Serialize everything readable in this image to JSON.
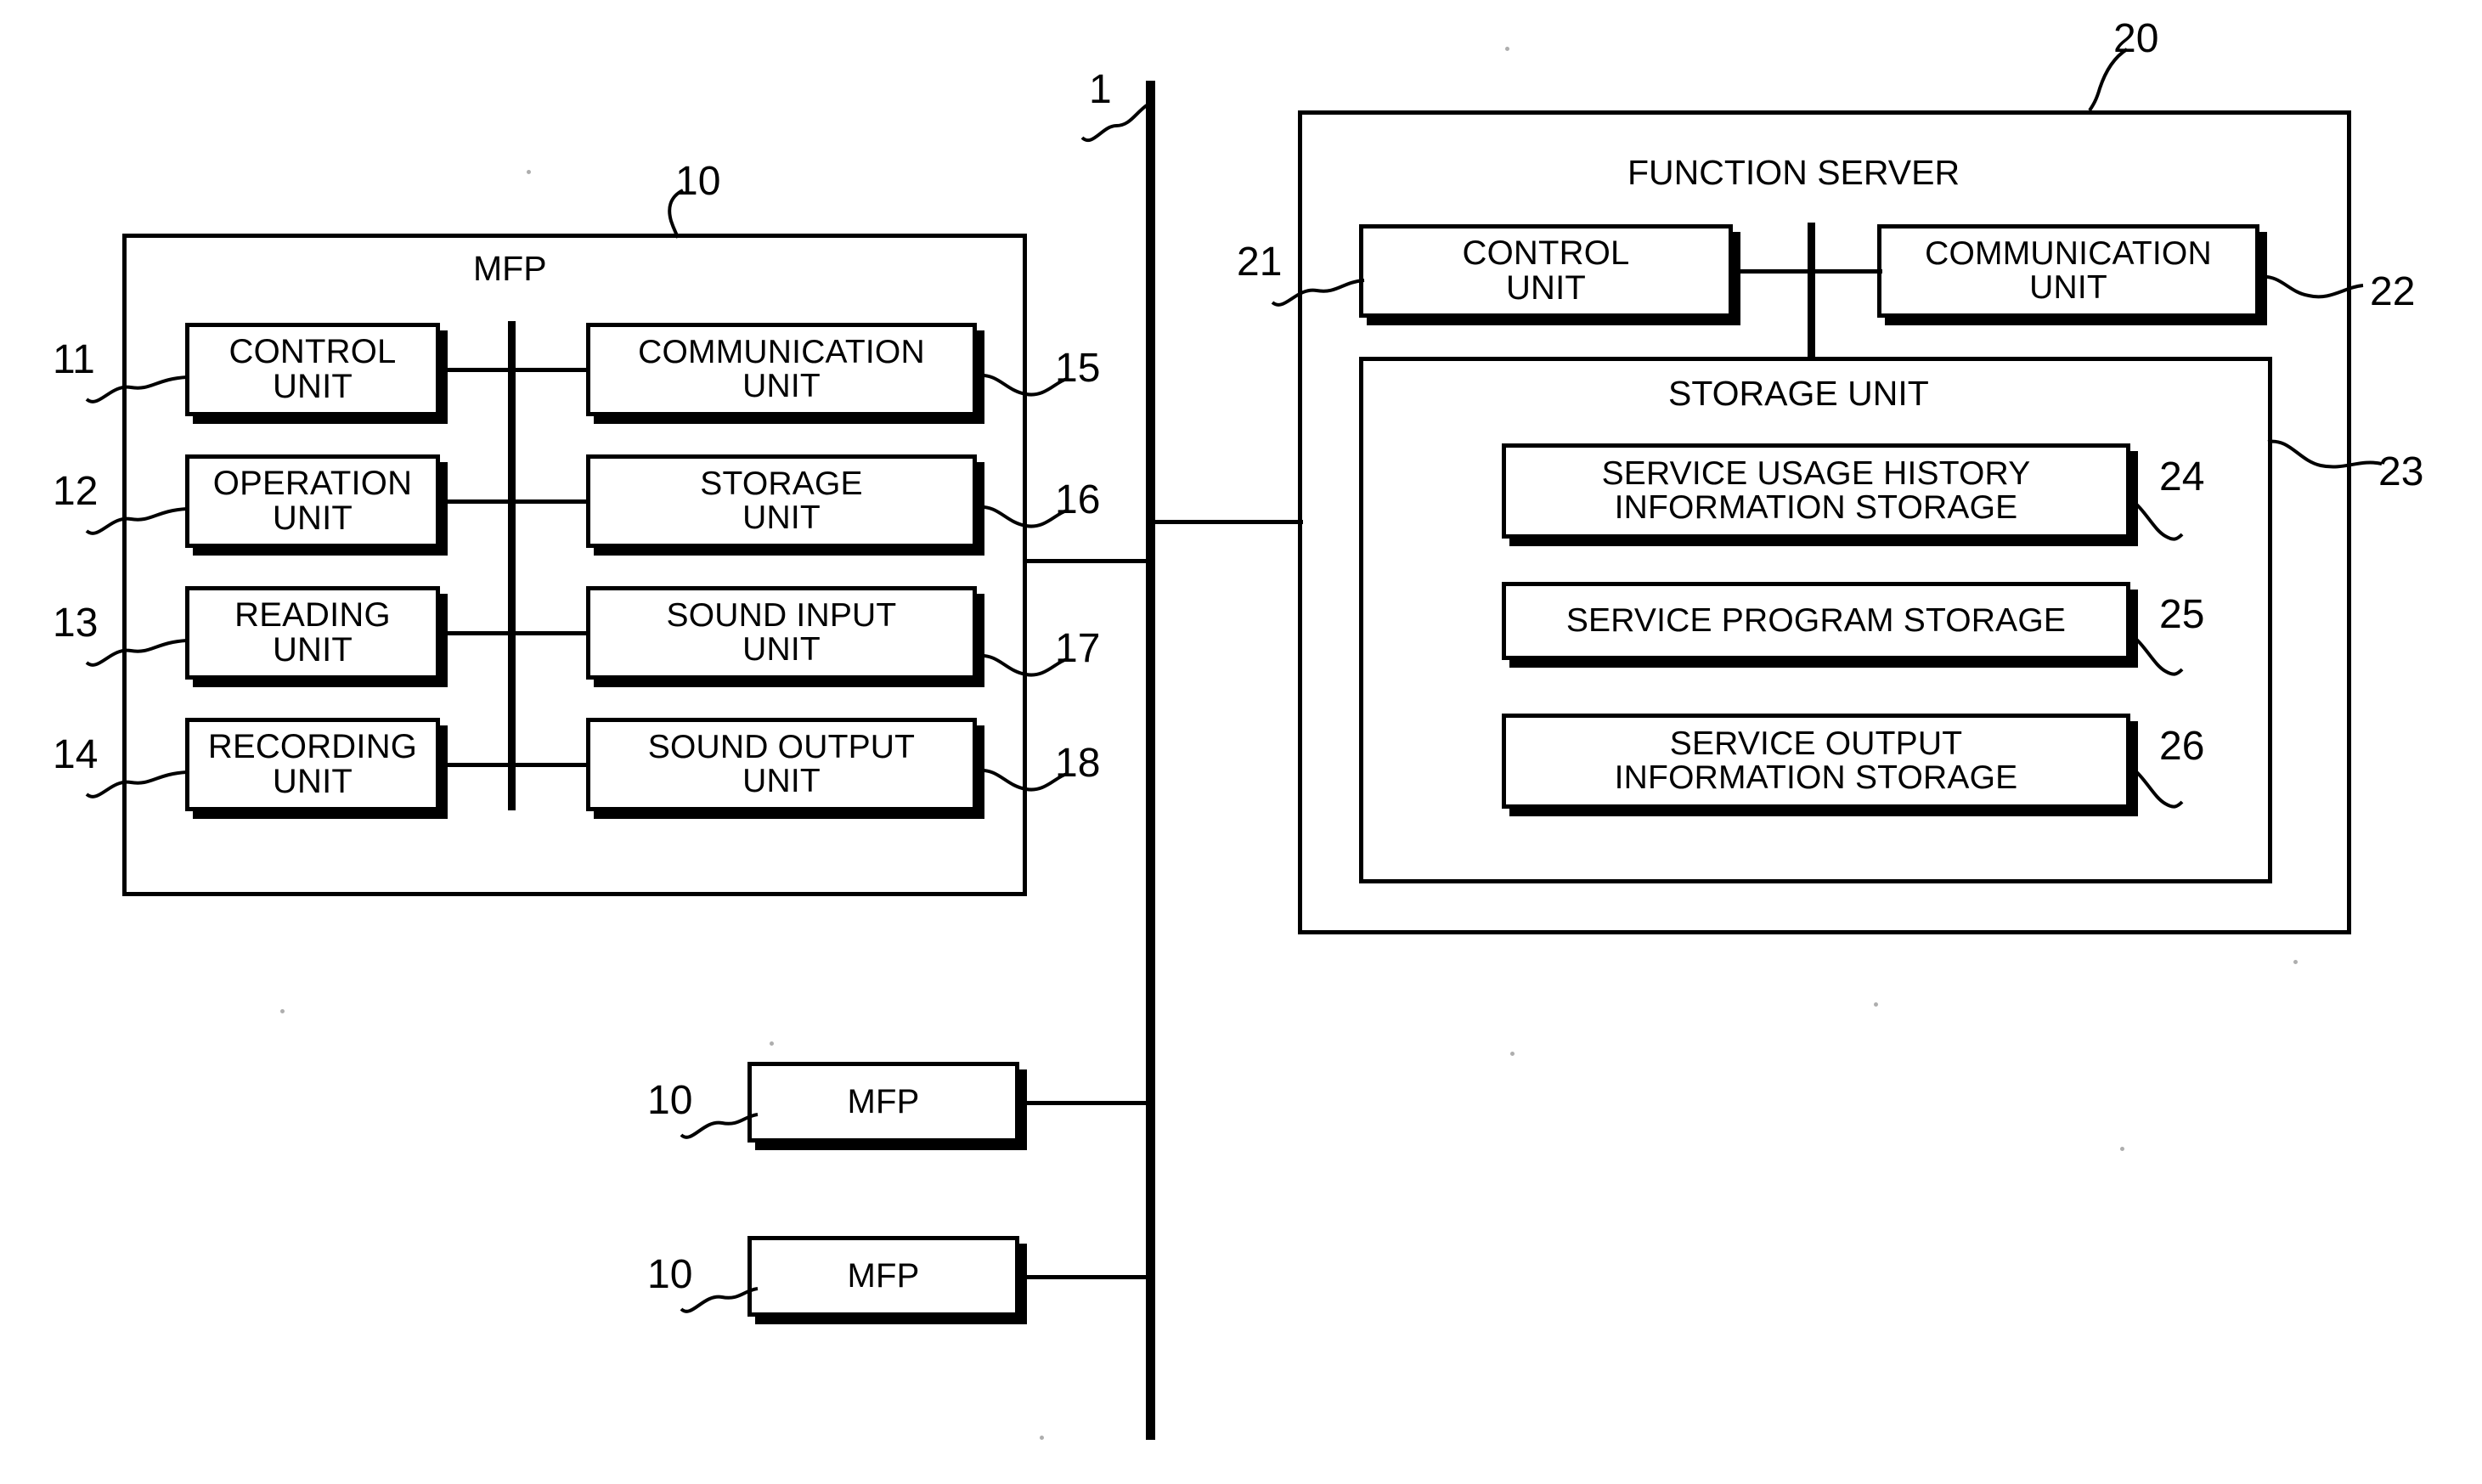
{
  "figure": {
    "network_bus_ref": "1",
    "mfp": {
      "title": "MFP",
      "ref": "10",
      "left_column": [
        {
          "ref": "11",
          "label": "CONTROL\nUNIT"
        },
        {
          "ref": "12",
          "label": "OPERATION\nUNIT"
        },
        {
          "ref": "13",
          "label": "READING\nUNIT"
        },
        {
          "ref": "14",
          "label": "RECORDING\nUNIT"
        }
      ],
      "right_column": [
        {
          "ref": "15",
          "label": "COMMUNICATION\nUNIT"
        },
        {
          "ref": "16",
          "label": "STORAGE\nUNIT"
        },
        {
          "ref": "17",
          "label": "SOUND INPUT\nUNIT"
        },
        {
          "ref": "18",
          "label": "SOUND OUTPUT\nUNIT"
        }
      ]
    },
    "additional_mfps": [
      {
        "ref": "10",
        "label": "MFP"
      },
      {
        "ref": "10",
        "label": "MFP"
      }
    ],
    "function_server": {
      "title": "FUNCTION SERVER",
      "ref": "20",
      "top_units": [
        {
          "ref": "21",
          "label": "CONTROL\nUNIT"
        },
        {
          "ref": "22",
          "label": "COMMUNICATION\nUNIT"
        }
      ],
      "storage_unit": {
        "title": "STORAGE UNIT",
        "ref": "23",
        "items": [
          {
            "ref": "24",
            "label": "SERVICE USAGE HISTORY\nINFORMATION STORAGE"
          },
          {
            "ref": "25",
            "label": "SERVICE PROGRAM STORAGE"
          },
          {
            "ref": "26",
            "label": "SERVICE OUTPUT\nINFORMATION STORAGE"
          }
        ]
      }
    }
  },
  "colors": {
    "ink": "#000000",
    "paper": "#ffffff"
  }
}
